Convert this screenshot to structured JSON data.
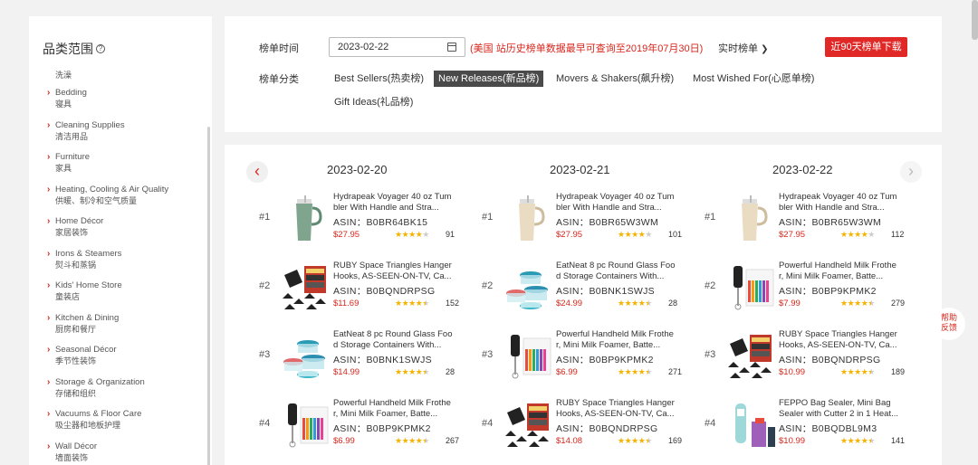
{
  "sidebar": {
    "title": "品类范围",
    "first_item": "洗澡",
    "items": [
      {
        "en": "Bedding",
        "cn": "寝具"
      },
      {
        "en": "Cleaning Supplies",
        "cn": "清洁用品"
      },
      {
        "en": "Furniture",
        "cn": "家具"
      },
      {
        "en": "Heating, Cooling & Air Quality",
        "cn": "供暖、制冷和空气质量"
      },
      {
        "en": "Home Décor",
        "cn": "家居装饰"
      },
      {
        "en": "Irons & Steamers",
        "cn": "熨斗和蒸锅"
      },
      {
        "en": "Kids' Home Store",
        "cn": "童装店"
      },
      {
        "en": "Kitchen & Dining",
        "cn": "厨房和餐厅"
      },
      {
        "en": "Seasonal Décor",
        "cn": "季节性装饰"
      },
      {
        "en": "Storage & Organization",
        "cn": "存储和组织"
      },
      {
        "en": "Vacuums & Floor Care",
        "cn": "吸尘器和地板护理"
      },
      {
        "en": "Wall Décor",
        "cn": "墙面装饰"
      }
    ]
  },
  "filters": {
    "time_label": "榜单时间",
    "date_value": "2023-02-22",
    "notice": "(美国 站历史榜单数据最早可查询至2019年07月30日)",
    "realtime_label": "实时榜单",
    "download_label": "近90天榜单下载",
    "category_label": "榜单分类",
    "tabs": [
      {
        "label": "Best Sellers(热卖榜)",
        "active": false
      },
      {
        "label": "New Releases(新品榜)",
        "active": true
      },
      {
        "label": "Movers & Shakers(飙升榜)",
        "active": false
      },
      {
        "label": "Most Wished For(心愿单榜)",
        "active": false
      },
      {
        "label": "Gift Ideas(礼品榜)",
        "active": false
      }
    ]
  },
  "results": {
    "columns": [
      {
        "date": "2023-02-20",
        "products": [
          {
            "rank": "#1",
            "title": "Hydrapeak Voyager 40 oz Tumbler With Handle and Stra...",
            "asin": "ASIN：B0BR64BK15",
            "price": "$27.95",
            "rating": 4,
            "reviews": "91",
            "thumb": "tumbler-green"
          },
          {
            "rank": "#2",
            "title": "RUBY Space Triangles Hanger Hooks, AS-SEEN-ON-TV, Ca...",
            "asin": "ASIN：B0BQNDRPSG",
            "price": "$11.69",
            "rating": 4.5,
            "reviews": "152",
            "thumb": "hanger-hooks"
          },
          {
            "rank": "#3",
            "title": "EatNeat 8 pc Round Glass Food Storage Containers With...",
            "asin": "ASIN：B0BNK1SWJS",
            "price": "$14.99",
            "rating": 4.5,
            "reviews": "28",
            "thumb": "glass-containers"
          },
          {
            "rank": "#4",
            "title": "Powerful Handheld Milk Frother, Mini Milk Foamer, Batte...",
            "asin": "ASIN：B0BP9KPMK2",
            "price": "$6.99",
            "rating": 4.5,
            "reviews": "267",
            "thumb": "milk-frother"
          }
        ]
      },
      {
        "date": "2023-02-21",
        "products": [
          {
            "rank": "#1",
            "title": "Hydrapeak Voyager 40 oz Tumbler With Handle and Stra...",
            "asin": "ASIN：B0BR65W3WM",
            "price": "$27.95",
            "rating": 4,
            "reviews": "101",
            "thumb": "tumbler-cream"
          },
          {
            "rank": "#2",
            "title": "EatNeat 8 pc Round Glass Food Storage Containers With...",
            "asin": "ASIN：B0BNK1SWJS",
            "price": "$24.99",
            "rating": 4.5,
            "reviews": "28",
            "thumb": "glass-containers"
          },
          {
            "rank": "#3",
            "title": "Powerful Handheld Milk Frother, Mini Milk Foamer, Batte...",
            "asin": "ASIN：B0BP9KPMK2",
            "price": "$6.99",
            "rating": 4.5,
            "reviews": "271",
            "thumb": "milk-frother"
          },
          {
            "rank": "#4",
            "title": "RUBY Space Triangles Hanger Hooks, AS-SEEN-ON-TV, Ca...",
            "asin": "ASIN：B0BQNDRPSG",
            "price": "$14.08",
            "rating": 4.5,
            "reviews": "169",
            "thumb": "hanger-hooks"
          }
        ]
      },
      {
        "date": "2023-02-22",
        "products": [
          {
            "rank": "#1",
            "title": "Hydrapeak Voyager 40 oz Tumbler With Handle and Stra...",
            "asin": "ASIN：B0BR65W3WM",
            "price": "$27.95",
            "rating": 4,
            "reviews": "112",
            "thumb": "tumbler-cream"
          },
          {
            "rank": "#2",
            "title": "Powerful Handheld Milk Frother, Mini Milk Foamer, Batte...",
            "asin": "ASIN：B0BP9KPMK2",
            "price": "$7.99",
            "rating": 4.5,
            "reviews": "279",
            "thumb": "milk-frother"
          },
          {
            "rank": "#3",
            "title": "RUBY Space Triangles Hanger Hooks, AS-SEEN-ON-TV, Ca...",
            "asin": "ASIN：B0BQNDRPSG",
            "price": "$10.99",
            "rating": 4.5,
            "reviews": "189",
            "thumb": "hanger-hooks"
          },
          {
            "rank": "#4",
            "title": "FEPPO Bag Sealer, Mini Bag Sealer with Cutter 2 in 1 Heat...",
            "asin": "ASIN：B0BQDBL9M3",
            "price": "$10.99",
            "rating": 4.5,
            "reviews": "141",
            "thumb": "bag-sealer"
          }
        ]
      }
    ]
  },
  "feedback_label": [
    "帮助",
    "反馈"
  ],
  "colors": {
    "accent": "#d9261c",
    "button": "#e02826",
    "active_tab": "#4a4a4a",
    "star": "#f5b301"
  }
}
